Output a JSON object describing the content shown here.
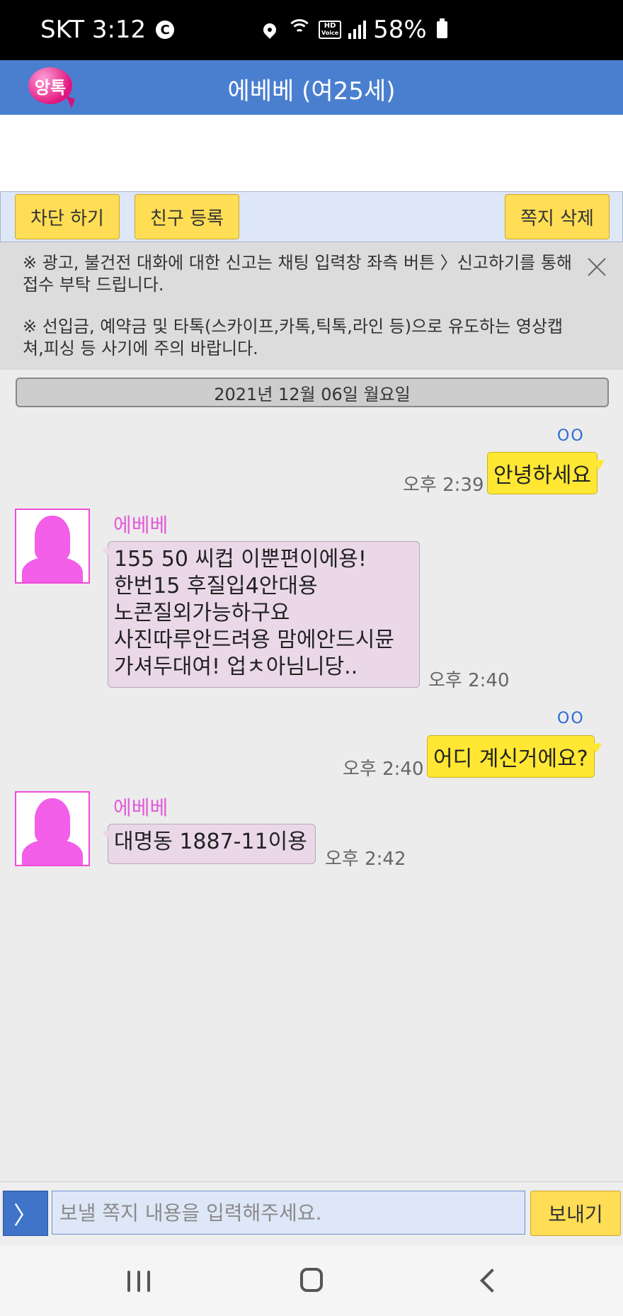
{
  "status_bar": {
    "carrier_time": "SKT 3:12",
    "c_icon": "C",
    "hd_label": "HD",
    "voice_label": "Voice",
    "battery": "58%"
  },
  "header": {
    "logo_text": "앙톡",
    "title": "에베베 (여25세)"
  },
  "toolbar": {
    "block_label": "차단 하기",
    "friend_label": "친구 등록",
    "delete_label": "쪽지 삭제"
  },
  "notice": {
    "line1": "※ 광고, 불건전 대화에 대한 신고는 채팅 입력창 좌측 버튼 〉신고하기를 통해 접수 부탁 드립니다.",
    "line2": "※ 선입금, 예약금 및 타톡(스카이프,카톡,틱톡,라인 등)으로 유도하는 영상캡쳐,피싱 등 사기에 주의 바랍니다."
  },
  "date_divider": "2021년 12월 06일 월요일",
  "messages": [
    {
      "direction": "out",
      "read_mark": "OO",
      "time": "오후 2:39",
      "text": "안녕하세요"
    },
    {
      "direction": "in",
      "sender": "에베베",
      "time": "오후 2:40",
      "lines": [
        "155 50 씨컵 이뿐편이에용!",
        "한번15 후질입4안대용",
        "노콘질외가능하구요",
        "사진따루안드려용  맘에안드시뮨",
        "가셔두대여! 업ㅊ아님니당.."
      ]
    },
    {
      "direction": "out",
      "read_mark": "OO",
      "time": "오후 2:40",
      "text": "어디 계신거에요?"
    },
    {
      "direction": "in",
      "sender": "에베베",
      "time": "오후 2:42",
      "lines": [
        "대명동 1887-11이용"
      ]
    }
  ],
  "input_bar": {
    "menu_label": "〉",
    "placeholder": "보낼 쪽지 내용을 입력해주세요.",
    "send_label": "보내기"
  }
}
